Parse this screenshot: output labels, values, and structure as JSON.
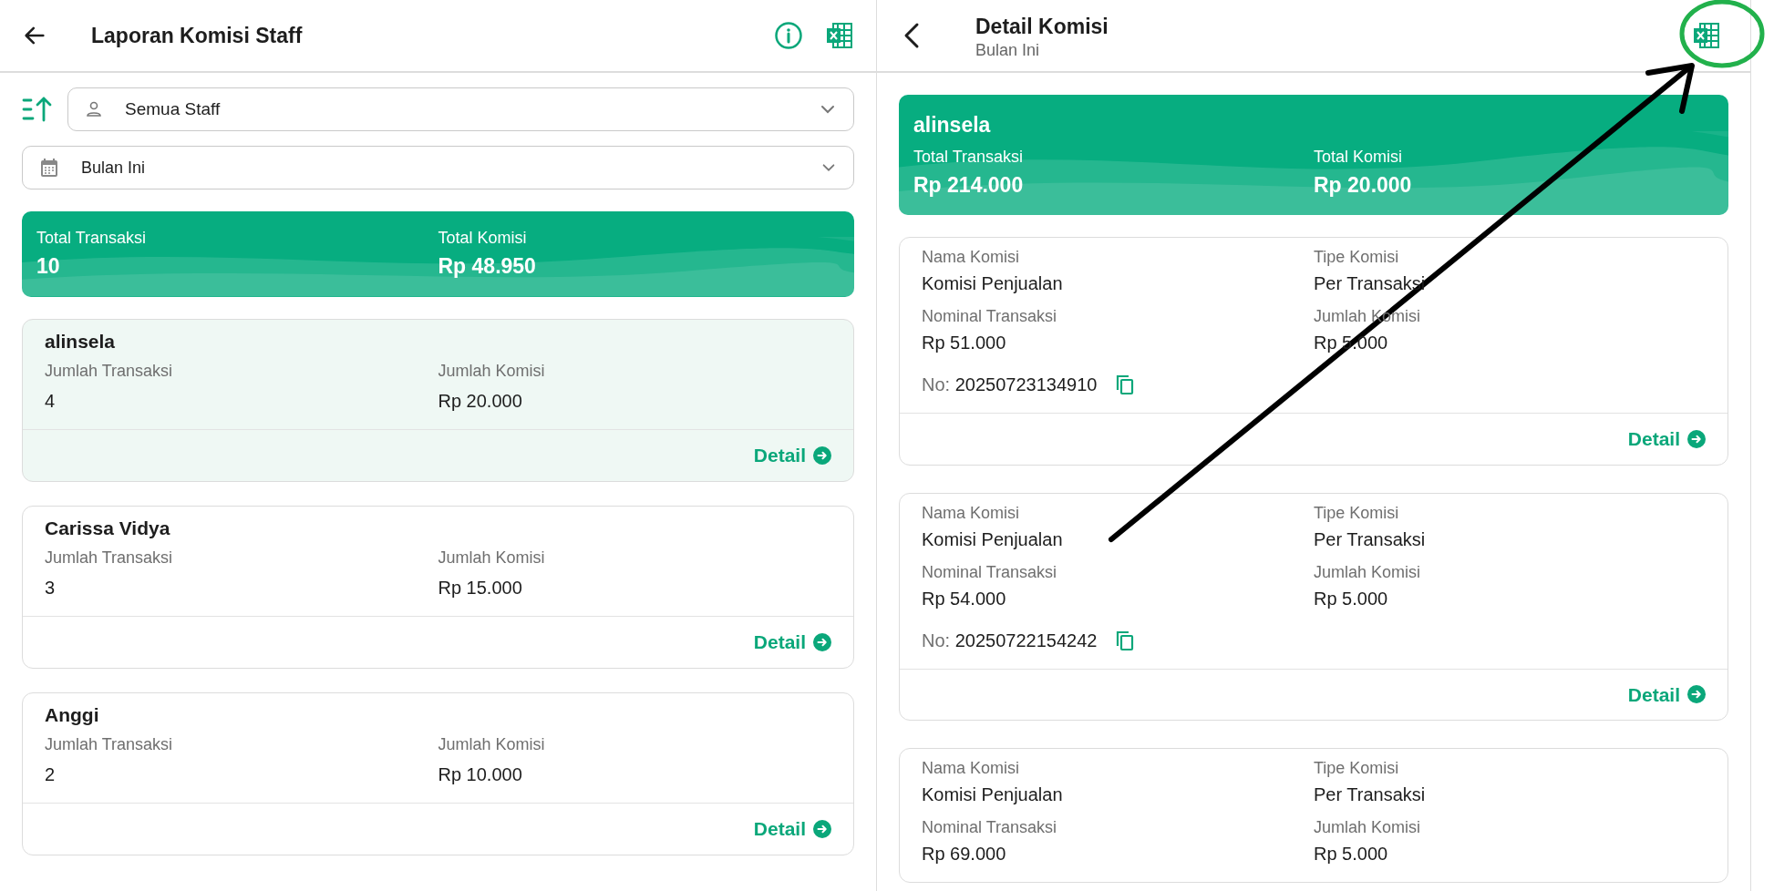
{
  "left_panel": {
    "title": "Laporan Komisi Staff",
    "staff_filter": {
      "value": "Semua Staff"
    },
    "period_filter": {
      "value": "Bulan Ini"
    },
    "summary": [
      {
        "label": "Total Transaksi",
        "value": "10"
      },
      {
        "label": "Total Komisi",
        "value": "Rp 48.950"
      }
    ],
    "staff": [
      {
        "name": "alinsela",
        "selected": true,
        "fields": [
          {
            "label": "Jumlah Transaksi",
            "value": "4"
          },
          {
            "label": "Jumlah Komisi",
            "value": "Rp 20.000"
          }
        ],
        "action": "Detail"
      },
      {
        "name": "Carissa Vidya",
        "selected": false,
        "fields": [
          {
            "label": "Jumlah Transaksi",
            "value": "3"
          },
          {
            "label": "Jumlah Komisi",
            "value": "Rp 15.000"
          }
        ],
        "action": "Detail"
      },
      {
        "name": "Anggi",
        "selected": false,
        "fields": [
          {
            "label": "Jumlah Transaksi",
            "value": "2"
          },
          {
            "label": "Jumlah Komisi",
            "value": "Rp 10.000"
          }
        ],
        "action": "Detail"
      }
    ]
  },
  "right_panel": {
    "title": "Detail Komisi",
    "subtitle": "Bulan Ini",
    "summary": {
      "name": "alinsela",
      "items": [
        {
          "label": "Total Transaksi",
          "value": "Rp 214.000"
        },
        {
          "label": "Total Komisi",
          "value": "Rp 20.000"
        }
      ]
    },
    "commissions": [
      {
        "fields": [
          {
            "label": "Nama Komisi",
            "value": "Komisi Penjualan"
          },
          {
            "label": "Tipe Komisi",
            "value": "Per Transaksi"
          },
          {
            "label": "Nominal Transaksi",
            "value": "Rp 51.000"
          },
          {
            "label": "Jumlah Komisi",
            "value": "Rp 5.000"
          }
        ],
        "number_label": "No:",
        "number": "20250723134910",
        "action": "Detail"
      },
      {
        "fields": [
          {
            "label": "Nama Komisi",
            "value": "Komisi Penjualan"
          },
          {
            "label": "Tipe Komisi",
            "value": "Per Transaksi"
          },
          {
            "label": "Nominal Transaksi",
            "value": "Rp 54.000"
          },
          {
            "label": "Jumlah Komisi",
            "value": "Rp 5.000"
          }
        ],
        "number_label": "No:",
        "number": "20250722154242",
        "action": "Detail"
      },
      {
        "fields": [
          {
            "label": "Nama Komisi",
            "value": "Komisi Penjualan"
          },
          {
            "label": "Tipe Komisi",
            "value": "Per Transaksi"
          },
          {
            "label": "Nominal Transaksi",
            "value": "Rp 69.000"
          },
          {
            "label": "Jumlah Komisi",
            "value": "Rp 5.000"
          }
        ]
      }
    ]
  }
}
